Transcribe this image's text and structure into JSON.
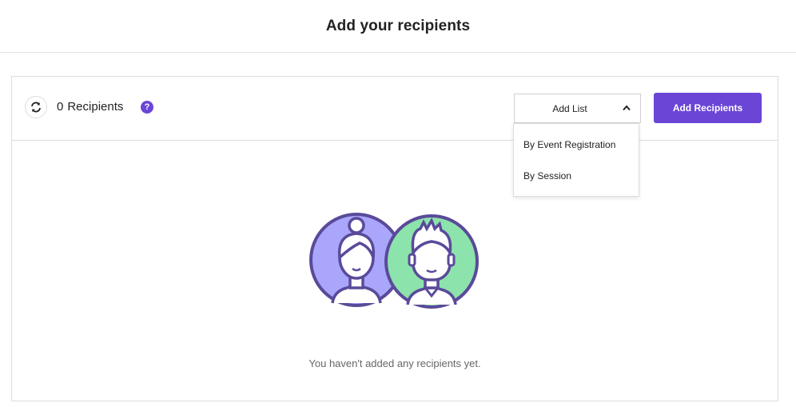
{
  "header": {
    "title": "Add your recipients"
  },
  "toolbar": {
    "refresh_icon": "refresh-icon",
    "recipient_count": "0",
    "recipient_label": "Recipients",
    "help_glyph": "?",
    "add_list": {
      "label": "Add List",
      "expanded": true,
      "options": [
        "By Event Registration",
        "By Session"
      ]
    },
    "add_recipients_label": "Add Recipients"
  },
  "empty_state": {
    "message": "You haven't added any recipients yet.",
    "illustration": "two-person-avatars-icon"
  },
  "colors": {
    "accent": "#6b45d6",
    "avatar_left_bg": "#a9a6fb",
    "avatar_right_bg": "#8de3ac",
    "outline": "#5a4a9a"
  }
}
